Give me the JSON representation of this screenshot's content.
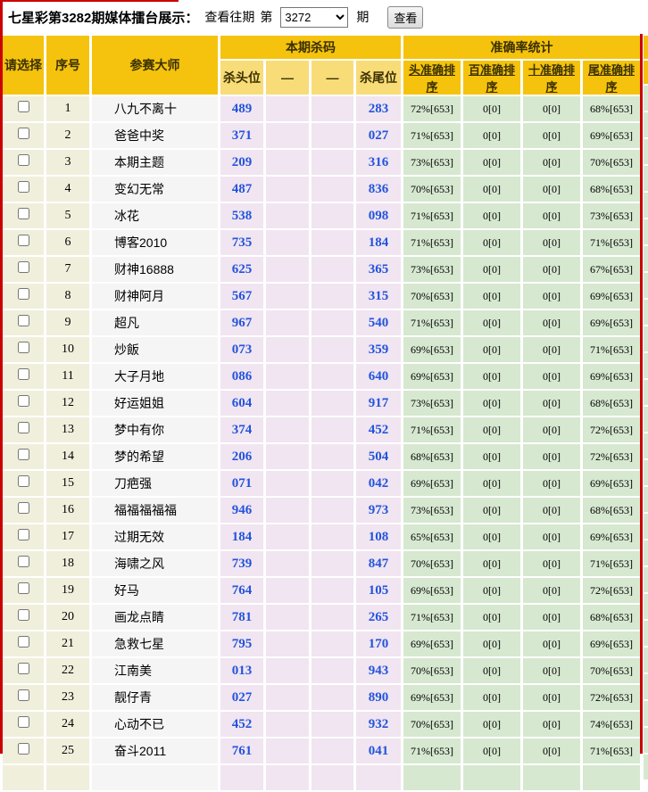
{
  "toolbar": {
    "title": "七星彩第3282期媒体擂台展示：",
    "view_past_label": "查看往期",
    "ordinal_prefix": "第",
    "period_selected": "3272",
    "ordinal_suffix": "期",
    "view_button_label": "查看"
  },
  "table": {
    "headers": {
      "select": "请选择",
      "index": "序号",
      "master": "参赛大师",
      "kill_group": "本期杀码",
      "accuracy_group": "准确率统计",
      "kill_head": "杀头位",
      "dash1": "—",
      "dash2": "—",
      "kill_tail": "杀尾位",
      "acc_head": "头准确排序",
      "acc_hundred": "百准确排序",
      "acc_ten": "十准确排序",
      "acc_tail": "尾准确排序"
    },
    "rows": [
      {
        "no": "1",
        "name": "八九不离十",
        "head": "489",
        "tail": "283",
        "acc_head": "72%[653]",
        "acc_hundred": "0[0]",
        "acc_ten": "0[0]",
        "acc_tail": "68%[653]"
      },
      {
        "no": "2",
        "name": "爸爸中奖",
        "head": "371",
        "tail": "027",
        "acc_head": "71%[653]",
        "acc_hundred": "0[0]",
        "acc_ten": "0[0]",
        "acc_tail": "69%[653]"
      },
      {
        "no": "3",
        "name": "本期主题",
        "head": "209",
        "tail": "316",
        "acc_head": "73%[653]",
        "acc_hundred": "0[0]",
        "acc_ten": "0[0]",
        "acc_tail": "70%[653]"
      },
      {
        "no": "4",
        "name": "变幻无常",
        "head": "487",
        "tail": "836",
        "acc_head": "70%[653]",
        "acc_hundred": "0[0]",
        "acc_ten": "0[0]",
        "acc_tail": "68%[653]"
      },
      {
        "no": "5",
        "name": "冰花",
        "head": "538",
        "tail": "098",
        "acc_head": "71%[653]",
        "acc_hundred": "0[0]",
        "acc_ten": "0[0]",
        "acc_tail": "73%[653]"
      },
      {
        "no": "6",
        "name": "博客2010",
        "head": "735",
        "tail": "184",
        "acc_head": "71%[653]",
        "acc_hundred": "0[0]",
        "acc_ten": "0[0]",
        "acc_tail": "71%[653]"
      },
      {
        "no": "7",
        "name": "财神16888",
        "head": "625",
        "tail": "365",
        "acc_head": "73%[653]",
        "acc_hundred": "0[0]",
        "acc_ten": "0[0]",
        "acc_tail": "67%[653]"
      },
      {
        "no": "8",
        "name": "财神阿月",
        "head": "567",
        "tail": "315",
        "acc_head": "70%[653]",
        "acc_hundred": "0[0]",
        "acc_ten": "0[0]",
        "acc_tail": "69%[653]"
      },
      {
        "no": "9",
        "name": "超凡",
        "head": "967",
        "tail": "540",
        "acc_head": "71%[653]",
        "acc_hundred": "0[0]",
        "acc_ten": "0[0]",
        "acc_tail": "69%[653]"
      },
      {
        "no": "10",
        "name": "炒飯",
        "head": "073",
        "tail": "359",
        "acc_head": "69%[653]",
        "acc_hundred": "0[0]",
        "acc_ten": "0[0]",
        "acc_tail": "71%[653]"
      },
      {
        "no": "11",
        "name": "大子月地",
        "head": "086",
        "tail": "640",
        "acc_head": "69%[653]",
        "acc_hundred": "0[0]",
        "acc_ten": "0[0]",
        "acc_tail": "69%[653]"
      },
      {
        "no": "12",
        "name": "好运姐姐",
        "head": "604",
        "tail": "917",
        "acc_head": "73%[653]",
        "acc_hundred": "0[0]",
        "acc_ten": "0[0]",
        "acc_tail": "68%[653]"
      },
      {
        "no": "13",
        "name": "梦中有你",
        "head": "374",
        "tail": "452",
        "acc_head": "71%[653]",
        "acc_hundred": "0[0]",
        "acc_ten": "0[0]",
        "acc_tail": "72%[653]"
      },
      {
        "no": "14",
        "name": "梦的希望",
        "head": "206",
        "tail": "504",
        "acc_head": "68%[653]",
        "acc_hundred": "0[0]",
        "acc_ten": "0[0]",
        "acc_tail": "72%[653]"
      },
      {
        "no": "15",
        "name": "刀疤强",
        "head": "071",
        "tail": "042",
        "acc_head": "69%[653]",
        "acc_hundred": "0[0]",
        "acc_ten": "0[0]",
        "acc_tail": "69%[653]"
      },
      {
        "no": "16",
        "name": "福福福福福",
        "head": "946",
        "tail": "973",
        "acc_head": "73%[653]",
        "acc_hundred": "0[0]",
        "acc_ten": "0[0]",
        "acc_tail": "68%[653]"
      },
      {
        "no": "17",
        "name": "过期无效",
        "head": "184",
        "tail": "108",
        "acc_head": "65%[653]",
        "acc_hundred": "0[0]",
        "acc_ten": "0[0]",
        "acc_tail": "69%[653]"
      },
      {
        "no": "18",
        "name": "海啸之风",
        "head": "739",
        "tail": "847",
        "acc_head": "70%[653]",
        "acc_hundred": "0[0]",
        "acc_ten": "0[0]",
        "acc_tail": "71%[653]"
      },
      {
        "no": "19",
        "name": "好马",
        "head": "764",
        "tail": "105",
        "acc_head": "69%[653]",
        "acc_hundred": "0[0]",
        "acc_ten": "0[0]",
        "acc_tail": "72%[653]"
      },
      {
        "no": "20",
        "name": "画龙点睛",
        "head": "781",
        "tail": "265",
        "acc_head": "71%[653]",
        "acc_hundred": "0[0]",
        "acc_ten": "0[0]",
        "acc_tail": "68%[653]"
      },
      {
        "no": "21",
        "name": "急救七星",
        "head": "795",
        "tail": "170",
        "acc_head": "69%[653]",
        "acc_hundred": "0[0]",
        "acc_ten": "0[0]",
        "acc_tail": "69%[653]"
      },
      {
        "no": "22",
        "name": "江南美",
        "head": "013",
        "tail": "943",
        "acc_head": "70%[653]",
        "acc_hundred": "0[0]",
        "acc_ten": "0[0]",
        "acc_tail": "70%[653]"
      },
      {
        "no": "23",
        "name": "靓仔青",
        "head": "027",
        "tail": "890",
        "acc_head": "69%[653]",
        "acc_hundred": "0[0]",
        "acc_ten": "0[0]",
        "acc_tail": "72%[653]"
      },
      {
        "no": "24",
        "name": "心动不已",
        "head": "452",
        "tail": "932",
        "acc_head": "70%[653]",
        "acc_hundred": "0[0]",
        "acc_ten": "0[0]",
        "acc_tail": "74%[653]"
      },
      {
        "no": "25",
        "name": "奋斗2011",
        "head": "761",
        "tail": "041",
        "acc_head": "71%[653]",
        "acc_hundred": "0[0]",
        "acc_ten": "0[0]",
        "acc_tail": "71%[653]"
      }
    ]
  },
  "colors": {
    "header_gold": "#F5C30D",
    "subheader_yellow": "#F8DC78",
    "cell_beige": "#F0EFDC",
    "cell_name_gray": "#F5F5F5",
    "cell_pink": "#F0E5F0",
    "cell_green": "#D6E8D0",
    "kill_number_blue": "#2353DD",
    "accent_red": "#CC0000"
  }
}
